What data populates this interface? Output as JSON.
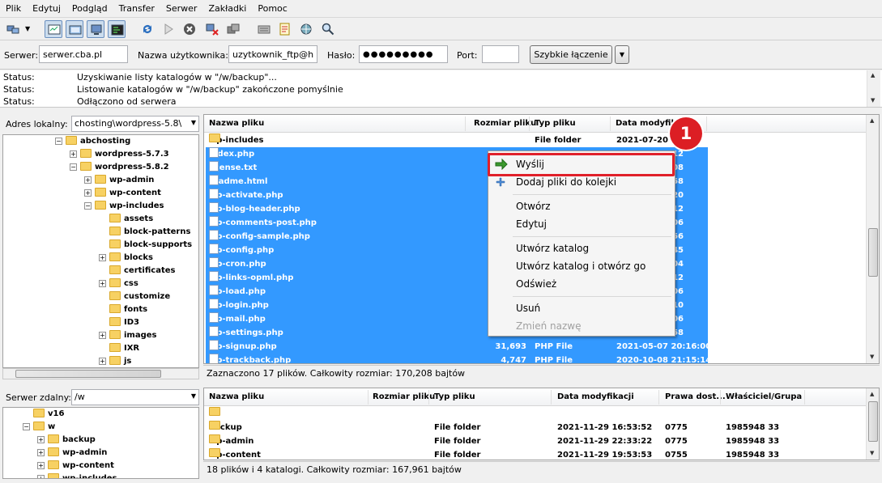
{
  "menu": [
    "Plik",
    "Edytuj",
    "Podgląd",
    "Transfer",
    "Serwer",
    "Zakładki",
    "Pomoc"
  ],
  "toolbar_icons": [
    "site-manager-icon",
    "dropdown-arrow-icon",
    "message-log-icon",
    "local-tree-icon",
    "remote-tree-icon",
    "transfer-queue-icon",
    "refresh-icon",
    "process-queue-icon",
    "cancel-icon",
    "disconnect-icon",
    "reconnect-icon",
    "filter-icon",
    "compare-icon",
    "sync-browse-icon",
    "search-icon"
  ],
  "quickconnect": {
    "server_label": "Serwer:",
    "server_value": "serwer.cba.pl",
    "user_label": "Nazwa użytkownika:",
    "user_value": "uzytkownik_ftp@ha",
    "pass_label": "Hasło:",
    "pass_value": "●●●●●●●●●",
    "port_label": "Port:",
    "port_value": "",
    "button": "Szybkie łączenie"
  },
  "log": [
    {
      "label": "Status:",
      "msg": "Uzyskiwanie listy katalogów w \"/w/backup\"..."
    },
    {
      "label": "Status:",
      "msg": "Listowanie katalogów w \"/w/backup\" zakończone pomyślnie"
    },
    {
      "label": "Status:",
      "msg": "Odłączono od serwera"
    }
  ],
  "local": {
    "addr_label": "Adres lokalny:",
    "addr_value": "chosting\\wordpress-5.8\\",
    "tree": [
      {
        "label": "abchosting",
        "indent": 0,
        "exp": "−"
      },
      {
        "label": "wordpress-5.7.3",
        "indent": 1,
        "exp": "+"
      },
      {
        "label": "wordpress-5.8.2",
        "indent": 1,
        "exp": "−"
      },
      {
        "label": "wp-admin",
        "indent": 2,
        "exp": "+"
      },
      {
        "label": "wp-content",
        "indent": 2,
        "exp": "+"
      },
      {
        "label": "wp-includes",
        "indent": 2,
        "exp": "−"
      },
      {
        "label": "assets",
        "indent": 3,
        "exp": ""
      },
      {
        "label": "block-patterns",
        "indent": 3,
        "exp": ""
      },
      {
        "label": "block-supports",
        "indent": 3,
        "exp": ""
      },
      {
        "label": "blocks",
        "indent": 3,
        "exp": "+"
      },
      {
        "label": "certificates",
        "indent": 3,
        "exp": ""
      },
      {
        "label": "css",
        "indent": 3,
        "exp": "+"
      },
      {
        "label": "customize",
        "indent": 3,
        "exp": ""
      },
      {
        "label": "fonts",
        "indent": 3,
        "exp": ""
      },
      {
        "label": "ID3",
        "indent": 3,
        "exp": ""
      },
      {
        "label": "images",
        "indent": 3,
        "exp": "+"
      },
      {
        "label": "IXR",
        "indent": 3,
        "exp": ""
      },
      {
        "label": "js",
        "indent": 3,
        "exp": "+"
      }
    ],
    "columns": [
      "Nazwa pliku",
      "Rozmiar pliku",
      "Typ pliku",
      "Data modyfikacji"
    ],
    "files": [
      {
        "name": "wp-includes",
        "size": "",
        "type": "File folder",
        "date": "2021-07-20 16:22",
        "folder": true,
        "sel": false
      },
      {
        "name": "index.php",
        "size": "",
        "type": "",
        "date": "12",
        "sel": true
      },
      {
        "name": "license.txt",
        "size": "",
        "type": "",
        "date": "08",
        "sel": true
      },
      {
        "name": "readme.html",
        "size": "",
        "type": "",
        "date": "58",
        "sel": true
      },
      {
        "name": "wp-activate.php",
        "size": "",
        "type": "",
        "date": "20",
        "sel": true
      },
      {
        "name": "wp-blog-header.php",
        "size": "",
        "type": "",
        "date": "12",
        "sel": true
      },
      {
        "name": "wp-comments-post.php",
        "size": "",
        "type": "",
        "date": "06",
        "sel": true
      },
      {
        "name": "wp-config-sample.php",
        "size": "",
        "type": "",
        "date": "56",
        "sel": true
      },
      {
        "name": "wp-config.php",
        "size": "",
        "type": "",
        "date": "45",
        "sel": true
      },
      {
        "name": "wp-cron.php",
        "size": "",
        "type": "",
        "date": "04",
        "sel": true
      },
      {
        "name": "wp-links-opml.php",
        "size": "",
        "type": "",
        "date": "12",
        "sel": true
      },
      {
        "name": "wp-load.php",
        "size": "",
        "type": "",
        "date": "06",
        "sel": true
      },
      {
        "name": "wp-login.php",
        "size": "",
        "type": "",
        "date": "10",
        "sel": true
      },
      {
        "name": "wp-mail.php",
        "size": "",
        "type": "",
        "date": "06",
        "sel": true
      },
      {
        "name": "wp-settings.php",
        "size": "",
        "type": "",
        "date": "58",
        "sel": true
      },
      {
        "name": "wp-signup.php",
        "size": "31,693",
        "type": "PHP File",
        "date": "2021-05-07 20:16:00",
        "sel": true
      },
      {
        "name": "wp-trackback.php",
        "size": "4,747",
        "type": "PHP File",
        "date": "2020-10-08 21:15:14",
        "sel": true
      }
    ],
    "status": "Zaznaczono 17 plików. Całkowity rozmiar: 170,208 bajtów"
  },
  "remote": {
    "addr_label": "Serwer zdalny:",
    "addr_value": "/w",
    "tree": [
      {
        "label": "v16",
        "indent": 0,
        "exp": ""
      },
      {
        "label": "w",
        "indent": 0,
        "exp": "−"
      },
      {
        "label": "backup",
        "indent": 1,
        "exp": "+"
      },
      {
        "label": "wp-admin",
        "indent": 1,
        "exp": "+"
      },
      {
        "label": "wp-content",
        "indent": 1,
        "exp": "+"
      },
      {
        "label": "wp-includes",
        "indent": 1,
        "exp": "+"
      }
    ],
    "columns": [
      "Nazwa pliku",
      "Rozmiar pliku",
      "Typ pliku",
      "Data modyfikacji",
      "Prawa dost...",
      "Właściciel/Grupa"
    ],
    "files": [
      {
        "name": "..",
        "type": "",
        "date": "",
        "perm": "",
        "owner": ""
      },
      {
        "name": "backup",
        "type": "File folder",
        "date": "2021-11-29 16:53:52",
        "perm": "0775",
        "owner": "1985948 33"
      },
      {
        "name": "wp-admin",
        "type": "File folder",
        "date": "2021-11-29 22:33:22",
        "perm": "0775",
        "owner": "1985948 33"
      },
      {
        "name": "wp-content",
        "type": "File folder",
        "date": "2021-11-29 19:53:53",
        "perm": "0755",
        "owner": "1985948 33"
      }
    ],
    "status": "18 plików i 4 katalogi. Całkowity rozmiar: 167,961 bajtów"
  },
  "context_menu": {
    "items": [
      {
        "label": "Wyślij",
        "icon": "upload-arrow-icon"
      },
      {
        "label": "Dodaj pliki do kolejki",
        "icon": "add-queue-icon"
      },
      {
        "label": "Otwórz"
      },
      {
        "label": "Edytuj"
      },
      {
        "label": "Utwórz katalog"
      },
      {
        "label": "Utwórz katalog i otwórz go"
      },
      {
        "label": "Odśwież"
      },
      {
        "label": "Usuń"
      },
      {
        "label": "Zmień nazwę",
        "disabled": true
      }
    ]
  },
  "badge": "1"
}
